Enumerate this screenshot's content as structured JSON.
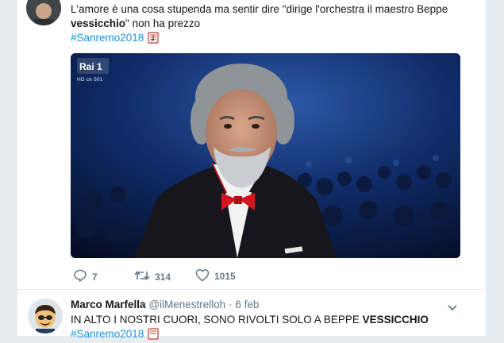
{
  "tweet1": {
    "text_line1": "L'amore è una cosa stupenda ma  sentir dire \"dirige l'orchestra il maestro Beppe",
    "text_bold": "vessicchio",
    "text_rest": "\" non ha prezzo",
    "hashtag": "#Sanremo2018",
    "hashtag_emoji": "music-score-icon",
    "media": {
      "channel_logo": "Rai 1",
      "channel_sub": "HD ch 501"
    },
    "actions": {
      "replies": "7",
      "retweets": "314",
      "likes": "1015"
    }
  },
  "tweet2": {
    "author_name": "Marco Marfella",
    "handle": "@ilMenestrelloh",
    "separator": "·",
    "date": "6 feb",
    "text_plain": "IN ALTO I NOSTRI CUORI, SONO RIVOLTI SOLO A BEPPE ",
    "text_bold": "VESSICCHIO",
    "hashtag": "#Sanremo2018"
  },
  "colors": {
    "link": "#1b95e0",
    "muted": "#657786",
    "background": "#e6ecf0"
  }
}
